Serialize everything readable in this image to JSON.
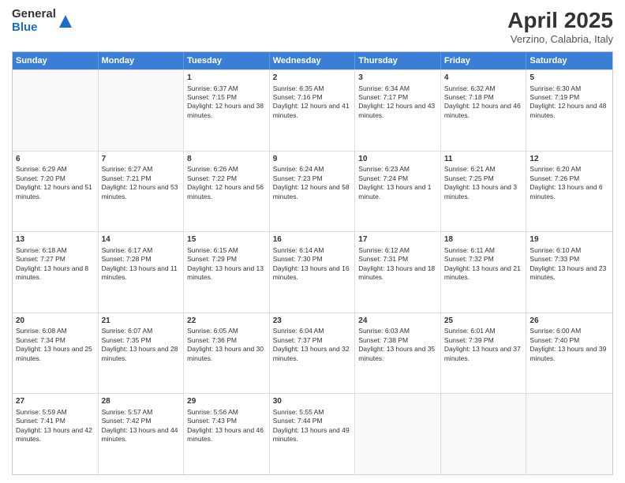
{
  "logo": {
    "general": "General",
    "blue": "Blue"
  },
  "header": {
    "title": "April 2025",
    "location": "Verzino, Calabria, Italy"
  },
  "weekdays": [
    "Sunday",
    "Monday",
    "Tuesday",
    "Wednesday",
    "Thursday",
    "Friday",
    "Saturday"
  ],
  "weeks": [
    [
      {
        "day": "",
        "sunrise": "",
        "sunset": "",
        "daylight": ""
      },
      {
        "day": "",
        "sunrise": "",
        "sunset": "",
        "daylight": ""
      },
      {
        "day": "1",
        "sunrise": "Sunrise: 6:37 AM",
        "sunset": "Sunset: 7:15 PM",
        "daylight": "Daylight: 12 hours and 38 minutes."
      },
      {
        "day": "2",
        "sunrise": "Sunrise: 6:35 AM",
        "sunset": "Sunset: 7:16 PM",
        "daylight": "Daylight: 12 hours and 41 minutes."
      },
      {
        "day": "3",
        "sunrise": "Sunrise: 6:34 AM",
        "sunset": "Sunset: 7:17 PM",
        "daylight": "Daylight: 12 hours and 43 minutes."
      },
      {
        "day": "4",
        "sunrise": "Sunrise: 6:32 AM",
        "sunset": "Sunset: 7:18 PM",
        "daylight": "Daylight: 12 hours and 46 minutes."
      },
      {
        "day": "5",
        "sunrise": "Sunrise: 6:30 AM",
        "sunset": "Sunset: 7:19 PM",
        "daylight": "Daylight: 12 hours and 48 minutes."
      }
    ],
    [
      {
        "day": "6",
        "sunrise": "Sunrise: 6:29 AM",
        "sunset": "Sunset: 7:20 PM",
        "daylight": "Daylight: 12 hours and 51 minutes."
      },
      {
        "day": "7",
        "sunrise": "Sunrise: 6:27 AM",
        "sunset": "Sunset: 7:21 PM",
        "daylight": "Daylight: 12 hours and 53 minutes."
      },
      {
        "day": "8",
        "sunrise": "Sunrise: 6:26 AM",
        "sunset": "Sunset: 7:22 PM",
        "daylight": "Daylight: 12 hours and 56 minutes."
      },
      {
        "day": "9",
        "sunrise": "Sunrise: 6:24 AM",
        "sunset": "Sunset: 7:23 PM",
        "daylight": "Daylight: 12 hours and 58 minutes."
      },
      {
        "day": "10",
        "sunrise": "Sunrise: 6:23 AM",
        "sunset": "Sunset: 7:24 PM",
        "daylight": "Daylight: 13 hours and 1 minute."
      },
      {
        "day": "11",
        "sunrise": "Sunrise: 6:21 AM",
        "sunset": "Sunset: 7:25 PM",
        "daylight": "Daylight: 13 hours and 3 minutes."
      },
      {
        "day": "12",
        "sunrise": "Sunrise: 6:20 AM",
        "sunset": "Sunset: 7:26 PM",
        "daylight": "Daylight: 13 hours and 6 minutes."
      }
    ],
    [
      {
        "day": "13",
        "sunrise": "Sunrise: 6:18 AM",
        "sunset": "Sunset: 7:27 PM",
        "daylight": "Daylight: 13 hours and 8 minutes."
      },
      {
        "day": "14",
        "sunrise": "Sunrise: 6:17 AM",
        "sunset": "Sunset: 7:28 PM",
        "daylight": "Daylight: 13 hours and 11 minutes."
      },
      {
        "day": "15",
        "sunrise": "Sunrise: 6:15 AM",
        "sunset": "Sunset: 7:29 PM",
        "daylight": "Daylight: 13 hours and 13 minutes."
      },
      {
        "day": "16",
        "sunrise": "Sunrise: 6:14 AM",
        "sunset": "Sunset: 7:30 PM",
        "daylight": "Daylight: 13 hours and 16 minutes."
      },
      {
        "day": "17",
        "sunrise": "Sunrise: 6:12 AM",
        "sunset": "Sunset: 7:31 PM",
        "daylight": "Daylight: 13 hours and 18 minutes."
      },
      {
        "day": "18",
        "sunrise": "Sunrise: 6:11 AM",
        "sunset": "Sunset: 7:32 PM",
        "daylight": "Daylight: 13 hours and 21 minutes."
      },
      {
        "day": "19",
        "sunrise": "Sunrise: 6:10 AM",
        "sunset": "Sunset: 7:33 PM",
        "daylight": "Daylight: 13 hours and 23 minutes."
      }
    ],
    [
      {
        "day": "20",
        "sunrise": "Sunrise: 6:08 AM",
        "sunset": "Sunset: 7:34 PM",
        "daylight": "Daylight: 13 hours and 25 minutes."
      },
      {
        "day": "21",
        "sunrise": "Sunrise: 6:07 AM",
        "sunset": "Sunset: 7:35 PM",
        "daylight": "Daylight: 13 hours and 28 minutes."
      },
      {
        "day": "22",
        "sunrise": "Sunrise: 6:05 AM",
        "sunset": "Sunset: 7:36 PM",
        "daylight": "Daylight: 13 hours and 30 minutes."
      },
      {
        "day": "23",
        "sunrise": "Sunrise: 6:04 AM",
        "sunset": "Sunset: 7:37 PM",
        "daylight": "Daylight: 13 hours and 32 minutes."
      },
      {
        "day": "24",
        "sunrise": "Sunrise: 6:03 AM",
        "sunset": "Sunset: 7:38 PM",
        "daylight": "Daylight: 13 hours and 35 minutes."
      },
      {
        "day": "25",
        "sunrise": "Sunrise: 6:01 AM",
        "sunset": "Sunset: 7:39 PM",
        "daylight": "Daylight: 13 hours and 37 minutes."
      },
      {
        "day": "26",
        "sunrise": "Sunrise: 6:00 AM",
        "sunset": "Sunset: 7:40 PM",
        "daylight": "Daylight: 13 hours and 39 minutes."
      }
    ],
    [
      {
        "day": "27",
        "sunrise": "Sunrise: 5:59 AM",
        "sunset": "Sunset: 7:41 PM",
        "daylight": "Daylight: 13 hours and 42 minutes."
      },
      {
        "day": "28",
        "sunrise": "Sunrise: 5:57 AM",
        "sunset": "Sunset: 7:42 PM",
        "daylight": "Daylight: 13 hours and 44 minutes."
      },
      {
        "day": "29",
        "sunrise": "Sunrise: 5:56 AM",
        "sunset": "Sunset: 7:43 PM",
        "daylight": "Daylight: 13 hours and 46 minutes."
      },
      {
        "day": "30",
        "sunrise": "Sunrise: 5:55 AM",
        "sunset": "Sunset: 7:44 PM",
        "daylight": "Daylight: 13 hours and 49 minutes."
      },
      {
        "day": "",
        "sunrise": "",
        "sunset": "",
        "daylight": ""
      },
      {
        "day": "",
        "sunrise": "",
        "sunset": "",
        "daylight": ""
      },
      {
        "day": "",
        "sunrise": "",
        "sunset": "",
        "daylight": ""
      }
    ]
  ]
}
